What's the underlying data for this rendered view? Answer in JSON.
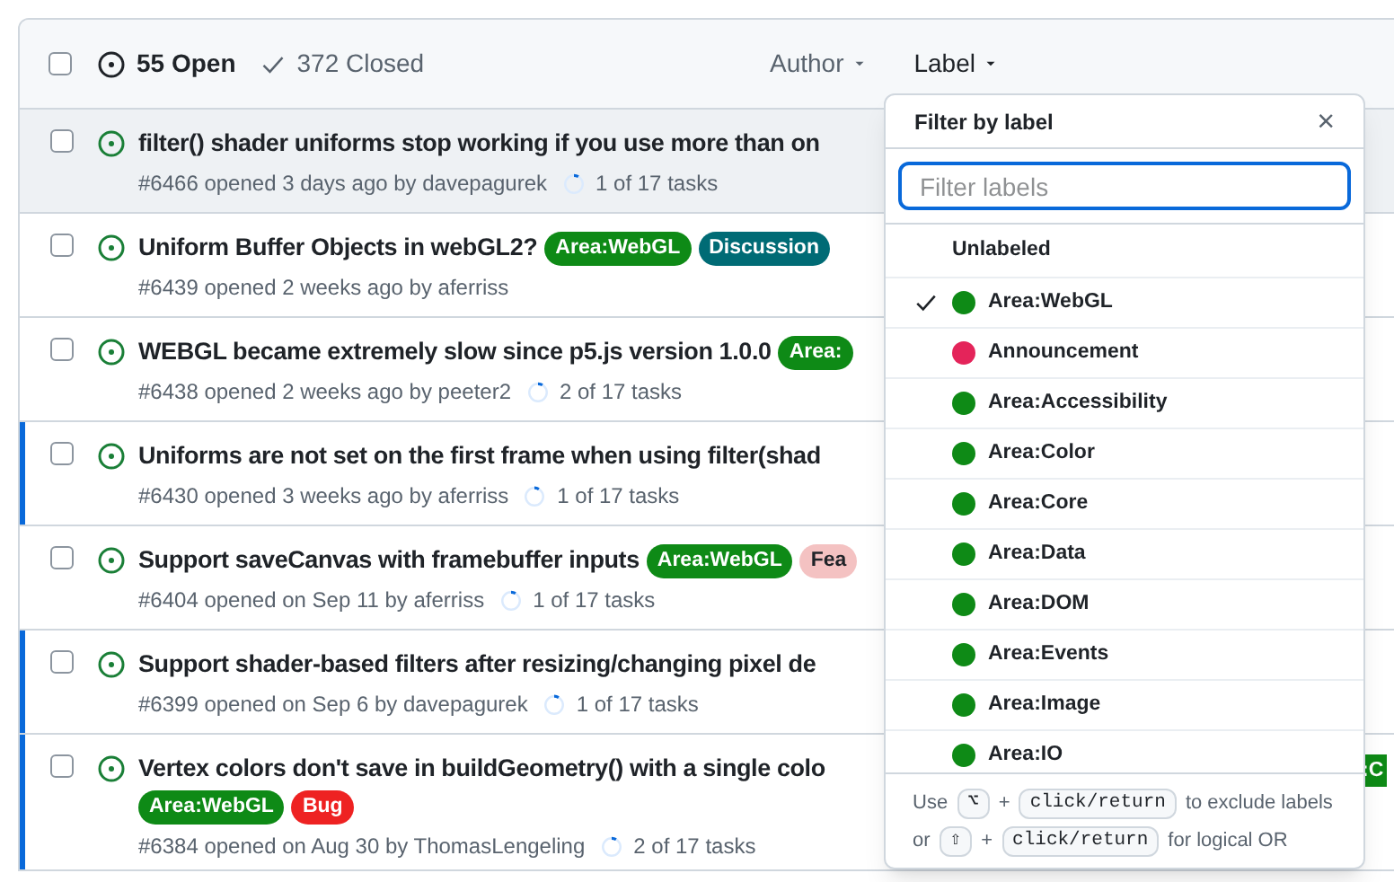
{
  "header": {
    "select_all": {
      "checked": false
    },
    "open_count": "55 Open",
    "closed_count": "372 Closed",
    "filters": [
      {
        "label": "Author",
        "active": false
      },
      {
        "label": "Label",
        "active": true
      }
    ]
  },
  "issues": [
    {
      "title": "filter() shader uniforms stop working if you use more than on",
      "checked": false,
      "meta": "#6466 opened 3 days ago by davepagurek",
      "tasks": "1 of 17 tasks",
      "hovered": true,
      "highlighted": false
    },
    {
      "title": "Uniform Buffer Objects in webGL2?",
      "checked": false,
      "labels": [
        {
          "text": "Area:WebGL",
          "color": "#0e8a16"
        },
        {
          "text": "Discussion",
          "color": "#006b75"
        }
      ],
      "meta": "#6439 opened 2 weeks ago by aferriss",
      "hovered": false,
      "highlighted": false
    },
    {
      "title": "WEBGL became extremely slow since p5.js version 1.0.0",
      "checked": false,
      "labels": [
        {
          "text": "Area:",
          "color": "#0e8a16"
        }
      ],
      "meta": "#6438 opened 2 weeks ago by peeter2",
      "tasks": "2 of 17 tasks",
      "hovered": false,
      "highlighted": false
    },
    {
      "title": "Uniforms are not set on the first frame when using filter(shad",
      "checked": false,
      "meta": "#6430 opened 3 weeks ago by aferriss",
      "tasks": "1 of 17 tasks",
      "hovered": false,
      "highlighted": true
    },
    {
      "title": "Support saveCanvas with framebuffer inputs",
      "checked": false,
      "labels": [
        {
          "text": "Area:WebGL",
          "color": "#0e8a16"
        },
        {
          "text": "Fea",
          "color": "#f4c2c2"
        }
      ],
      "meta": "#6404 opened on Sep 11 by aferriss",
      "tasks": "1 of 17 tasks",
      "hovered": false,
      "highlighted": false
    },
    {
      "title": "Support shader-based filters after resizing/changing pixel de",
      "checked": false,
      "meta": "#6399 opened on Sep 6 by davepagurek",
      "tasks": "1 of 17 tasks",
      "hovered": false,
      "highlighted": true
    },
    {
      "title": "Vertex colors don't save in buildGeometry() with a single colo",
      "checked": false,
      "labels": [
        {
          "text": "Area:WebGL",
          "color": "#0e8a16"
        },
        {
          "text": "Bug",
          "color": "#ee2222"
        }
      ],
      "edge_label": {
        "text": ":C",
        "color": "#0e8a16"
      },
      "meta": "#6384 opened on Aug 30 by ThomasLengeling",
      "tasks": "2 of 17 tasks",
      "hovered": false,
      "highlighted": true
    }
  ],
  "label_menu": {
    "title": "Filter by label",
    "close": "×",
    "search": {
      "placeholder": "Filter labels"
    },
    "items": [
      {
        "name": "Unlabeled",
        "selected": false
      },
      {
        "name": "Area:WebGL",
        "color": "#0e8a16",
        "selected": true
      },
      {
        "name": "Announcement",
        "color": "#e4245a",
        "selected": false
      },
      {
        "name": "Area:Accessibility",
        "color": "#0e8a16",
        "selected": false
      },
      {
        "name": "Area:Color",
        "color": "#0e8a16",
        "selected": false
      },
      {
        "name": "Area:Core",
        "color": "#0e8a16",
        "selected": false
      },
      {
        "name": "Area:Data",
        "color": "#0e8a16",
        "selected": false
      },
      {
        "name": "Area:DOM",
        "color": "#0e8a16",
        "selected": false
      },
      {
        "name": "Area:Events",
        "color": "#0e8a16",
        "selected": false
      },
      {
        "name": "Area:Image",
        "color": "#0e8a16",
        "selected": false
      },
      {
        "name": "Area:IO",
        "color": "#0e8a16",
        "selected": false
      }
    ],
    "hints": [
      [
        {
          "kind": "text",
          "text": "Use"
        },
        {
          "kind": "key",
          "text": "⌥"
        },
        {
          "kind": "text",
          "text": "+"
        },
        {
          "kind": "key",
          "text": "click/return"
        },
        {
          "kind": "text",
          "text": "to exclude labels"
        }
      ],
      [
        {
          "kind": "text",
          "text": "or"
        },
        {
          "kind": "key",
          "text": "⇧"
        },
        {
          "kind": "text",
          "text": "+"
        },
        {
          "kind": "key",
          "text": "click/return"
        },
        {
          "kind": "text",
          "text": "for logical OR"
        }
      ]
    ]
  }
}
